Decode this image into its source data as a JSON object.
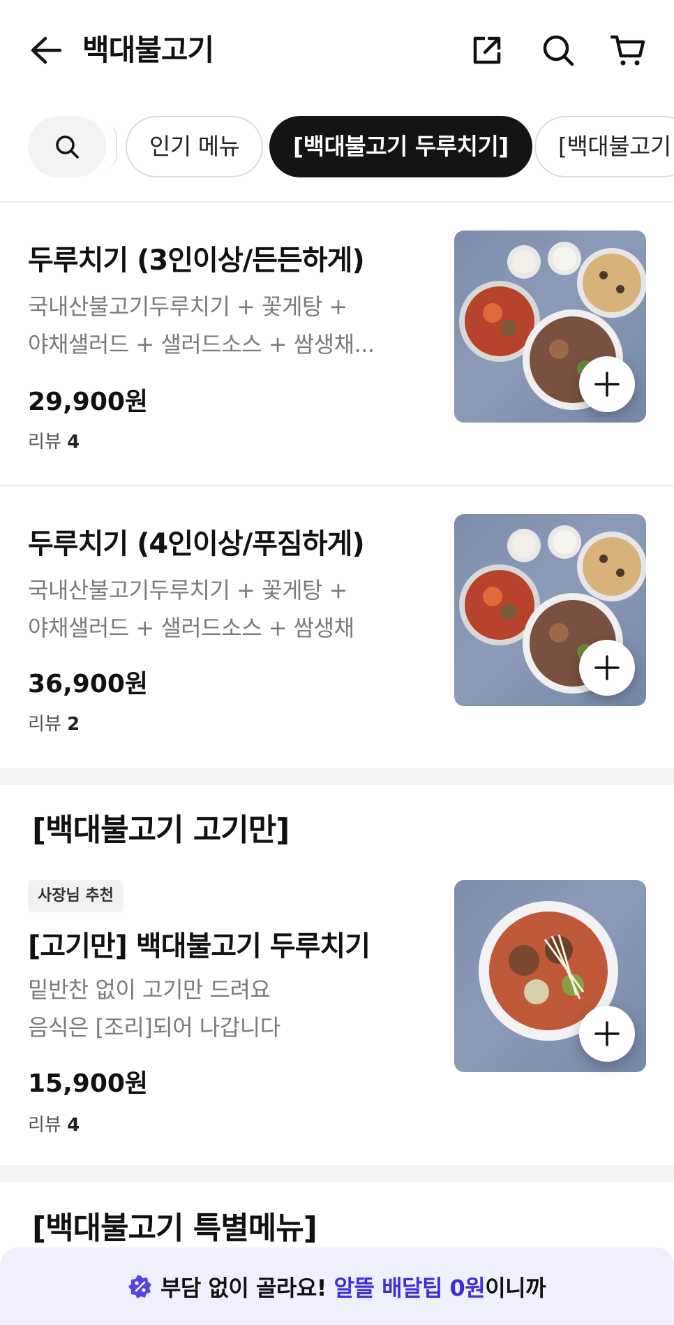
{
  "header": {
    "title": "백대불고기",
    "icons": [
      "back-arrow-icon",
      "share-icon",
      "search-icon",
      "cart-icon"
    ]
  },
  "tabs": [
    {
      "label": "인기 메뉴",
      "active": false
    },
    {
      "label": "[백대불고기 두루치기]",
      "active": true
    },
    {
      "label": "[백대불고기",
      "active": false
    }
  ],
  "items": [
    {
      "name": "두루치기 (3인이상/든든하게)",
      "desc_line1": "국내산불고기두루치기 + 꽃게탕 +",
      "desc_line2": "야채샐러드 + 샐러드소스 + 쌈생채...",
      "price": "29,900원",
      "review_label": "리뷰",
      "review_count": "4"
    },
    {
      "name": "두루치기 (4인이상/푸짐하게)",
      "desc_line1": "국내산불고기두루치기 + 꽃게탕 +",
      "desc_line2": "야채샐러드 + 샐러드소스 + 쌈생채",
      "price": "36,900원",
      "review_label": "리뷰",
      "review_count": "2"
    }
  ],
  "sections": [
    {
      "title": "[백대불고기 고기만]",
      "items": [
        {
          "badge": "사장님 추천",
          "name": "[고기만] 백대불고기 두루치기",
          "desc_line1": "밑반찬 없이 고기만 드려요",
          "desc_line2": "음식은 [조리]되어 나갑니다",
          "price": "15,900원",
          "review_label": "리뷰",
          "review_count": "4"
        }
      ]
    },
    {
      "title": "[백대불고기 특별메뉴]"
    }
  ],
  "banner": {
    "text_before": "부담 없이 골라요!",
    "highlight": "알뜰 배달팁 0원",
    "text_after": "이니까",
    "icon": "discount-badge-icon"
  },
  "colors": {
    "accent": "#3f2dd6",
    "active_tab_bg": "#141414",
    "banner_bg": "#eff0fb"
  }
}
